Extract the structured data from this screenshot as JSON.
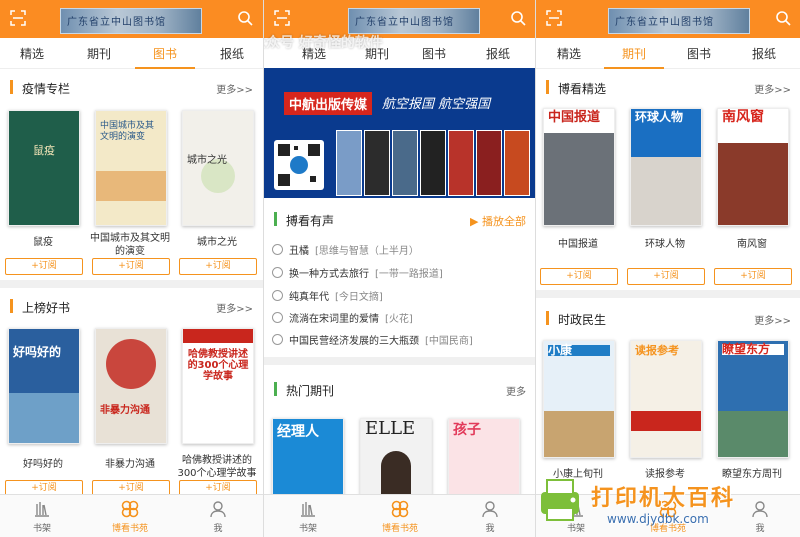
{
  "banner_text": "广东省立中山图书馆",
  "panel1": {
    "tabs": [
      "精选",
      "期刊",
      "图书",
      "报纸"
    ],
    "active_tab": 2,
    "section1": {
      "title": "疫情专栏",
      "more": "更多>>"
    },
    "books1": [
      {
        "name": "鼠疫",
        "cover_text": "鼠疫"
      },
      {
        "name": "中国城市及其文明的演变",
        "cover_text": "中国城市及其文明的演变"
      },
      {
        "name": "城市之光",
        "cover_text": "城市之光"
      }
    ],
    "subscribe": "+订阅",
    "section2": {
      "title": "上榜好书",
      "more": "更多>>"
    },
    "books2": [
      {
        "name": "好吗好的",
        "cover_text": "好吗好的"
      },
      {
        "name": "非暴力沟通",
        "cover_text": "非暴力沟通"
      },
      {
        "name": "哈佛教授讲述的300个心理学故事",
        "cover_text": "哈佛教授讲述的300个心理学故事"
      }
    ]
  },
  "panel2": {
    "tabs": [
      "精选",
      "期刊",
      "图书",
      "报纸"
    ],
    "watermark": "微信公众号 好奇怪的软件",
    "ad": {
      "title": "中航出版传媒",
      "slogan": "航空报国 航空强国"
    },
    "audio": {
      "title": "搏看有声",
      "play_all": "播放全部"
    },
    "playlist": [
      {
        "title": "丑橘",
        "tag": "[思维与智慧（上半月）"
      },
      {
        "title": "换一种方式去旅行",
        "tag": "[一带一路报道]"
      },
      {
        "title": "纯真年代",
        "tag": "[今日文摘]"
      },
      {
        "title": "流淌在宋词里的爱情",
        "tag": "[火花]"
      },
      {
        "title": "中国民营经济发展的三大瓶颈",
        "tag": "[中国民商]"
      }
    ],
    "hot": {
      "title": "热门期刊",
      "more": "更多"
    },
    "hot_mags": [
      "经理人",
      "ELLE",
      "孩子"
    ]
  },
  "panel3": {
    "tabs": [
      "精选",
      "期刊",
      "图书",
      "报纸"
    ],
    "active_tab": 1,
    "section1": {
      "title": "博看精选",
      "more": "更多>>"
    },
    "mags1": [
      {
        "name": "中国报道",
        "cover_text": "中国报道"
      },
      {
        "name": "环球人物",
        "cover_text": "环球人物"
      },
      {
        "name": "南风窗",
        "cover_text": "南风窗"
      }
    ],
    "subscribe": "+订阅",
    "section2": {
      "title": "时政民生",
      "more": "更多>>"
    },
    "mags2": [
      {
        "name": "小康上旬刊",
        "cover_text": "小康"
      },
      {
        "name": "读报参考",
        "cover_text": "读报参考"
      },
      {
        "name": "瞭望东方周刊",
        "cover_text": "瞭望东方"
      }
    ]
  },
  "nav": [
    "书架",
    "博看书苑",
    "我"
  ],
  "site_watermark": {
    "title": "打印机大百科",
    "url": "www.djydbk.com"
  },
  "colors": {
    "accent": "#f5931e",
    "topbar": "#fb8c22"
  }
}
